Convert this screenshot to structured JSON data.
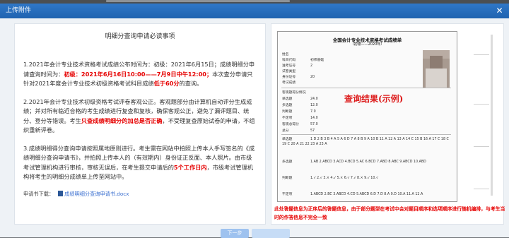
{
  "window": {
    "title": "上传附件",
    "close_glyph": "✕"
  },
  "instructions": {
    "heading": "明细分查询申请必读事项",
    "p1_a": "1.2021年会计专业技术资格考试成绩公布时间为：初级：2021年6月15日；成绩明细分申请查询时间为：",
    "p1_red1": "初级：2021年6月16日10:00——7月9日中午12:00；",
    "p1_b": "本次查分申请只针对2021年度会计专业技术初级资格考试科目成绩",
    "p1_red2": "低于60分",
    "p1_c": "的查询。",
    "p2_a": "2.2021年会计专业技术初级资格考试评卷客观公正。客观题部分由计算机自动评分生成成绩；并对所有临近合格的考生成绩进行复查和复核，确保客观公正，避免了漏评题目、统分、登分等错误。考生",
    "p2_red": "只查成绩明细分的加总是否正确",
    "p2_b": "，不受理复查原始试卷的申请，不组织重新评卷。",
    "p3_a": "3.成绩明细得分查询申请按照属地原则进行。考生需在网站中拍照上传本人手写签名的《成绩明细分查询申请书》，并拍照上传本人的（有效期内）身份证正反面、本人照片。由市级考试管理机构进行审核，审核无误后，在考生提交申请后的",
    "p3_red": "5个工作日内",
    "p3_b": "，市级考试管理机构将考生的明细分成绩单上传至网站中。",
    "download_label": "申请书下载：",
    "download_link": "成绩明细分查询申请书.docx"
  },
  "sample": {
    "title": "全国会计专业技术资格考试成绩单",
    "subtitle": "（初级——2020年）",
    "stamp": "查询结果(示例)",
    "fields": [
      {
        "label": "姓名",
        "value": ""
      },
      {
        "label": "科目代码",
        "value": "初师基础"
      },
      {
        "label": "准考证号",
        "value": "2"
      },
      {
        "label": "试卷类型",
        "value": ""
      },
      {
        "label": "身份证号",
        "value": "20"
      },
      {
        "label": "考试成绩",
        "value": ""
      }
    ],
    "detail_header": "客观题得分情况",
    "scores": [
      {
        "label": "单选题",
        "value": "24.0"
      },
      {
        "label": "多选题",
        "value": "12.0"
      },
      {
        "label": "判断题",
        "value": "7.0"
      },
      {
        "label": "不定项",
        "value": "14.0"
      },
      {
        "label": "客观总得分",
        "value": "57.0"
      },
      {
        "label": "总分",
        "value": "57"
      }
    ],
    "answers": [
      {
        "label": "单选题",
        "value": "1 D 2 B 3 B 4 A 5 A 6 D 7 A 8 B 9 A 10 B 11 A 12 A 13 A 14 C 15 B 16 A 17 C 18 C 19 C 20 A 21 22 23 A 23 A"
      },
      {
        "label": "多选题",
        "value": "1.AB  2.ABCD 3.ACD  4.BCD  5.AC  6.BCD  7.ABD  8.ABC  9.ABCD 10.ABD"
      },
      {
        "label": "判断题",
        "value": "1.√   2.√   3.×   4.√   5.×   6.√   7.√   8.×   9.√   10.√"
      },
      {
        "label": "不定项",
        "value": "1.ABCD 2.BC  3.ABCD 4.CD  5.ABCD 6.D 7.D 8.A 9.D 10.A 11.A 12.A"
      }
    ],
    "note": "此处答题信息为正序后的答题信息，由于部分题型在考试中会对题目顺序和选项顺序进行随机编排，与考生当时的作答信息不完全一致"
  },
  "footer": {
    "next_label": "下一步",
    "second_label": ""
  },
  "colors": {
    "accent": "#1f63b0",
    "warning": "#e60000"
  }
}
